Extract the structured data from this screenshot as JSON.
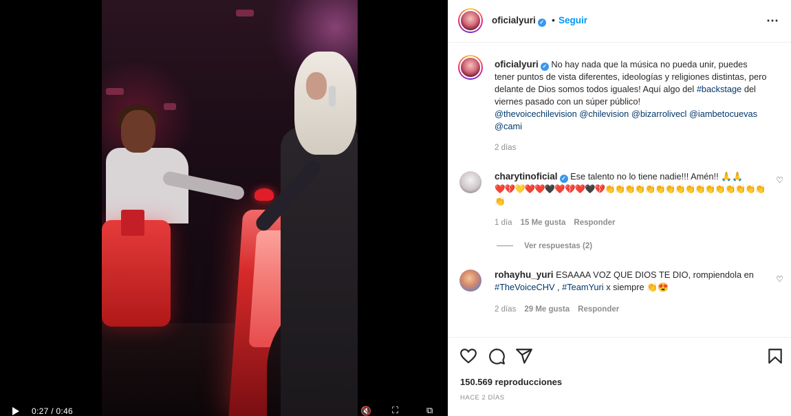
{
  "video": {
    "time": "0:27 / 0:46"
  },
  "header": {
    "username": "oficialyuri",
    "follow_label": "Seguir"
  },
  "caption": {
    "username": "oficialyuri",
    "text_1": "No hay nada que la música no pueda unir, puedes tener puntos de vista diferentes, ideologías y religiones distintas, pero delante de Dios somos todos iguales! Aquí algo del ",
    "hashtag": "#backstage",
    "text_2": " del viernes pasado con un súper público!",
    "mentions": "@thevoicechilevision @chilevision @bizarrolivecl @iambetocuevas @cami",
    "time": "2 días"
  },
  "comments": [
    {
      "username": "charytinoficial",
      "text": "Ese talento no lo tiene nadie!!! Amén!! 🙏🙏",
      "emoji_line": "❤️💔💛❤️❤️🖤❤️💔❤️🖤💔👏👏👏👏👏👏👏👏👏👏👏👏👏👏👏👏👏",
      "time": "1 día",
      "likes": "15 Me gusta",
      "reply_label": "Responder",
      "view_replies": "Ver respuestas (2)"
    },
    {
      "username": "rohayhu_yuri",
      "text_1": "ESAAAA VOZ QUE DIOS TE DIO, rompiendola en ",
      "hashtag_1": "#TheVoiceCHV",
      "sep": " , ",
      "hashtag_2": "#TeamYuri",
      "text_2": " x siempre 👏😍",
      "time": "2 días",
      "likes": "29 Me gusta",
      "reply_label": "Responder"
    }
  ],
  "footer": {
    "views": "150.569 reproducciones",
    "posted": "HACE 2 DÍAS"
  },
  "icons": {
    "like": "heart-icon",
    "comment": "comment-icon",
    "share": "share-icon",
    "save": "bookmark-icon"
  },
  "colors": {
    "link": "#00376b",
    "follow": "#0095f6",
    "verified": "#3897f0"
  }
}
